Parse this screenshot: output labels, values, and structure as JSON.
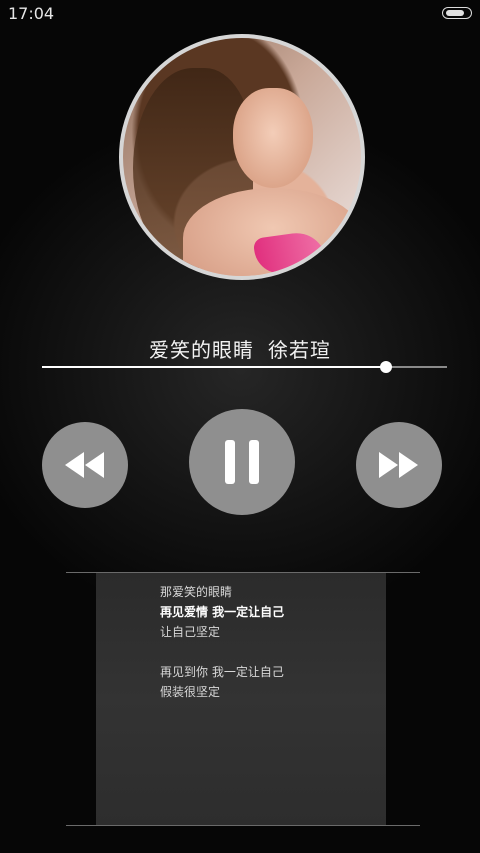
{
  "status_bar": {
    "time": "17:04",
    "battery_level": 0.85
  },
  "song": {
    "title": "爱笑的眼睛",
    "artist": "徐若瑄"
  },
  "progress": {
    "fraction": 0.85
  },
  "controls": {
    "prev_icon": "rewind-icon",
    "play_icon": "pause-icon",
    "next_icon": "fast-forward-icon"
  },
  "lyrics": [
    {
      "text": "那爱笑的眼睛",
      "current": false
    },
    {
      "text": "再见爱情  我一定让自己",
      "current": true
    },
    {
      "text": "让自己坚定",
      "current": false
    },
    {
      "text": "",
      "current": false
    },
    {
      "text": "再见到你  我一定让自己",
      "current": false
    },
    {
      "text": "假装很坚定",
      "current": false
    }
  ],
  "colors": {
    "accent": "#ffffff",
    "button": "#8f8f8f"
  }
}
